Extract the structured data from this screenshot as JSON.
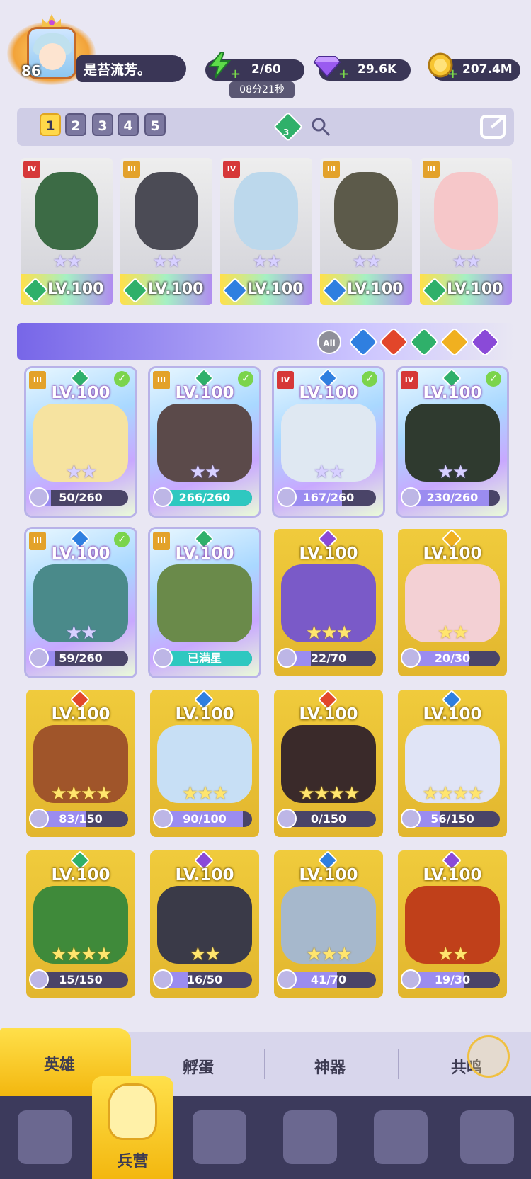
{
  "player": {
    "level": "86",
    "name": "是苔流芳。"
  },
  "resources": {
    "energy": "2/60",
    "energy_timer": "08分21秒",
    "gems": "29.6K",
    "gold": "207.4M"
  },
  "team_tabs": [
    "1",
    "2",
    "3",
    "4",
    "5"
  ],
  "team_power_badge": "3",
  "team": [
    {
      "rank": "IV",
      "element": "wind",
      "level": "LV.100"
    },
    {
      "rank": "III",
      "element": "wind",
      "level": "LV.100"
    },
    {
      "rank": "IV",
      "element": "water",
      "level": "LV.100"
    },
    {
      "rank": "III",
      "element": "water",
      "level": "LV.100"
    },
    {
      "rank": "III",
      "element": "wind",
      "level": "LV.100"
    }
  ],
  "filters": {
    "all": "All",
    "elements": [
      "water",
      "fire",
      "wind",
      "light",
      "dark"
    ]
  },
  "heroes": [
    {
      "level": "LV.100",
      "rank": "III",
      "element": "wind",
      "progress": "50/260",
      "fill": 0.19,
      "owned": true
    },
    {
      "level": "LV.100",
      "rank": "III",
      "element": "wind",
      "progress": "266/260",
      "fill": 1.0,
      "owned": true
    },
    {
      "level": "LV.100",
      "rank": "IV",
      "element": "water",
      "progress": "167/260",
      "fill": 0.64,
      "owned": true
    },
    {
      "level": "LV.100",
      "rank": "IV",
      "element": "wind",
      "progress": "230/260",
      "fill": 0.88,
      "owned": true
    },
    {
      "level": "LV.100",
      "rank": "III",
      "element": "water",
      "progress": "59/260",
      "fill": 0.23,
      "owned": true
    },
    {
      "level": "LV.100",
      "rank": "III",
      "element": "wind",
      "progress": "已满星",
      "fill": 1.0,
      "owned": true
    },
    {
      "level": "LV.100",
      "element": "dark",
      "progress": "22/70",
      "fill": 0.31,
      "owned": false
    },
    {
      "level": "LV.100",
      "element": "light",
      "progress": "20/30",
      "fill": 0.67,
      "owned": false
    },
    {
      "level": "LV.100",
      "element": "fire",
      "progress": "83/150",
      "fill": 0.55,
      "owned": false
    },
    {
      "level": "LV.100",
      "element": "water",
      "progress": "90/100",
      "fill": 0.9,
      "owned": false
    },
    {
      "level": "LV.100",
      "element": "fire",
      "progress": "0/150",
      "fill": 0.0,
      "owned": false
    },
    {
      "level": "LV.100",
      "element": "water",
      "progress": "56/150",
      "fill": 0.37,
      "owned": false
    },
    {
      "level": "LV.100",
      "element": "wind",
      "progress": "15/150",
      "fill": 0.1,
      "owned": false
    },
    {
      "level": "LV.100",
      "element": "dark",
      "progress": "16/50",
      "fill": 0.32,
      "owned": false
    },
    {
      "level": "LV.100",
      "element": "water",
      "progress": "41/70",
      "fill": 0.59,
      "owned": false
    },
    {
      "level": "LV.100",
      "element": "dark",
      "progress": "19/30",
      "fill": 0.63,
      "owned": false
    }
  ],
  "subtabs": [
    "英雄",
    "孵蛋",
    "神器",
    "共鸣"
  ],
  "nav": {
    "active_label": "兵营"
  },
  "colors": {
    "water": "#2f7fe0",
    "fire": "#e2462a",
    "wind": "#2fb06a",
    "light": "#f0b020",
    "dark": "#8a4ad8"
  }
}
